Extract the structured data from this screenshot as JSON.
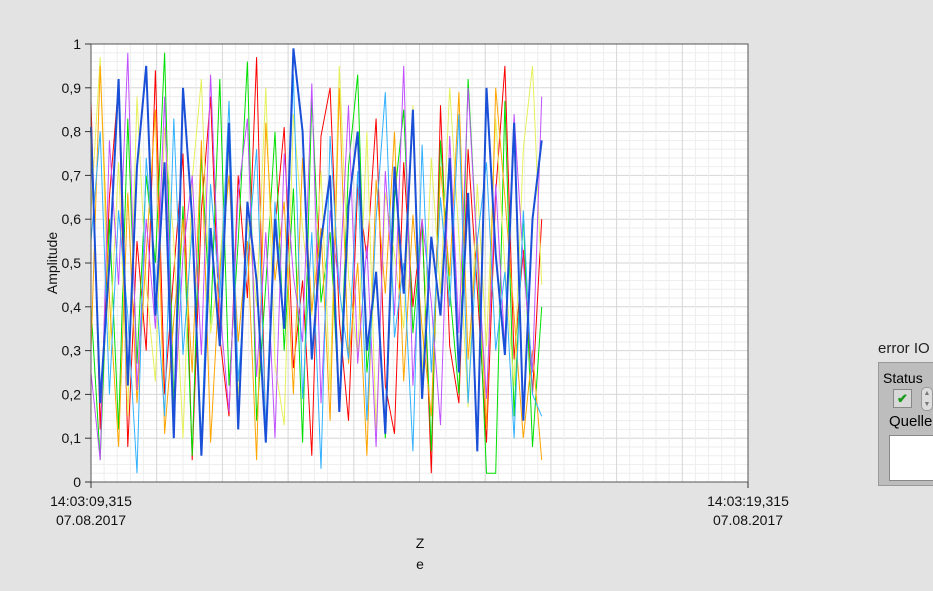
{
  "chart_data": {
    "type": "line",
    "ylabel": "Amplitude",
    "xlabel_lines": [
      "Z",
      "e"
    ],
    "ylim": [
      0,
      1
    ],
    "xlim": [
      0,
      10
    ],
    "yticks": [
      "0",
      "0,1",
      "0,2",
      "0,3",
      "0,4",
      "0,5",
      "0,6",
      "0,7",
      "0,8",
      "0,9",
      "1"
    ],
    "xticks": [
      {
        "time": "14:03:09,315",
        "date": "07.08.2017"
      },
      {
        "time": "14:03:19,315",
        "date": "07.08.2017"
      }
    ],
    "grid": true,
    "dt": 0.14,
    "series": [
      {
        "name": "red",
        "color": "#ff0000",
        "values": [
          0.87,
          0.12,
          0.65,
          0.91,
          0.08,
          0.55,
          0.3,
          0.94,
          0.2,
          0.48,
          0.75,
          0.05,
          0.62,
          0.88,
          0.33,
          0.15,
          0.7,
          0.42,
          0.97,
          0.1,
          0.58,
          0.81,
          0.26,
          0.46,
          0.06,
          0.79,
          0.9,
          0.37,
          0.14,
          0.68,
          0.51,
          0.83,
          0.22,
          0.11,
          0.73,
          0.4,
          0.6,
          0.02,
          0.86,
          0.31,
          0.18,
          0.76,
          0.44,
          0.09,
          0.66,
          0.95,
          0.28,
          0.53,
          0.2,
          0.6
        ]
      },
      {
        "name": "green",
        "color": "#00e000",
        "values": [
          0.4,
          0.05,
          0.6,
          0.12,
          0.83,
          0.27,
          0.7,
          0.5,
          0.98,
          0.18,
          0.63,
          0.06,
          0.75,
          0.36,
          0.92,
          0.22,
          0.55,
          0.96,
          0.14,
          0.45,
          0.8,
          0.3,
          0.67,
          0.09,
          0.88,
          0.41,
          0.57,
          0.17,
          0.72,
          0.93,
          0.25,
          0.48,
          0.1,
          0.65,
          0.85,
          0.34,
          0.59,
          0.07,
          0.78,
          0.44,
          0.2,
          0.92,
          0.52,
          0.02,
          0.02,
          0.87,
          0.15,
          0.61,
          0.08,
          0.4
        ]
      },
      {
        "name": "yellow",
        "color": "#e6f05a",
        "values": [
          0.62,
          0.97,
          0.3,
          0.73,
          0.15,
          0.88,
          0.45,
          0.23,
          0.81,
          0.55,
          0.1,
          0.69,
          0.92,
          0.34,
          0.5,
          0.76,
          0.19,
          0.6,
          0.4,
          0.9,
          0.27,
          0.13,
          0.84,
          0.58,
          0.38,
          0.71,
          0.21,
          0.95,
          0.47,
          0.29,
          0.8,
          0.12,
          0.66,
          0.52,
          0.35,
          0.86,
          0.24,
          0.74,
          0.43,
          0.9,
          0.56,
          0.17,
          0.68,
          0.31,
          0.83,
          0.49,
          0.22,
          0.76,
          0.95,
          0.45
        ]
      },
      {
        "name": "orange",
        "color": "#ffa500",
        "values": [
          0.3,
          0.95,
          0.42,
          0.08,
          0.66,
          0.18,
          0.52,
          0.85,
          0.11,
          0.37,
          0.6,
          0.25,
          0.78,
          0.09,
          0.48,
          0.7,
          0.32,
          0.55,
          0.05,
          0.82,
          0.46,
          0.64,
          0.2,
          0.74,
          0.39,
          0.58,
          0.14,
          0.9,
          0.27,
          0.5,
          0.06,
          0.69,
          0.43,
          0.8,
          0.23,
          0.61,
          0.35,
          0.15,
          0.72,
          0.47,
          0.89,
          0.28,
          0.56,
          0.12,
          0.9,
          0.65,
          0.38,
          0.1,
          0.3,
          0.05
        ]
      },
      {
        "name": "violet",
        "color": "#c050ff",
        "values": [
          0.25,
          0.05,
          0.78,
          0.45,
          0.98,
          0.21,
          0.6,
          0.35,
          0.88,
          0.13,
          0.52,
          0.7,
          0.29,
          0.93,
          0.4,
          0.16,
          0.66,
          0.83,
          0.24,
          0.57,
          0.1,
          0.75,
          0.47,
          0.32,
          0.91,
          0.18,
          0.62,
          0.44,
          0.86,
          0.27,
          0.54,
          0.08,
          0.71,
          0.38,
          0.95,
          0.22,
          0.6,
          0.41,
          0.13,
          0.79,
          0.34,
          0.9,
          0.52,
          0.19,
          0.68,
          0.3,
          0.84,
          0.5,
          0.25,
          0.88
        ]
      },
      {
        "name": "cyan",
        "color": "#30b0ff",
        "values": [
          0.55,
          0.8,
          0.2,
          0.62,
          0.38,
          0.02,
          0.74,
          0.47,
          0.15,
          0.83,
          0.29,
          0.58,
          0.09,
          0.68,
          0.42,
          0.87,
          0.23,
          0.51,
          0.76,
          0.12,
          0.64,
          0.35,
          0.93,
          0.19,
          0.57,
          0.03,
          0.79,
          0.44,
          0.28,
          0.71,
          0.14,
          0.6,
          0.89,
          0.33,
          0.5,
          0.07,
          0.77,
          0.25,
          0.65,
          0.4,
          0.84,
          0.18,
          0.55,
          0.73,
          0.3,
          0.48,
          0.1,
          0.62,
          0.2,
          0.15
        ]
      },
      {
        "name": "blue",
        "color": "#1a4fd8",
        "values": [
          0.81,
          0.18,
          0.5,
          0.92,
          0.22,
          0.72,
          0.95,
          0.38,
          0.73,
          0.1,
          0.9,
          0.6,
          0.06,
          0.58,
          0.31,
          0.82,
          0.12,
          0.64,
          0.46,
          0.09,
          0.6,
          0.35,
          0.99,
          0.8,
          0.28,
          0.55,
          0.7,
          0.16,
          0.63,
          0.8,
          0.3,
          0.48,
          0.11,
          0.72,
          0.43,
          0.85,
          0.19,
          0.56,
          0.38,
          0.74,
          0.25,
          0.66,
          0.07,
          0.9,
          0.52,
          0.29,
          0.82,
          0.14,
          0.6,
          0.78
        ]
      }
    ]
  },
  "error_io": {
    "label": "error IO",
    "status_label": "Status",
    "status_check": "✔",
    "source_label": "Quelle",
    "source_value": ""
  }
}
